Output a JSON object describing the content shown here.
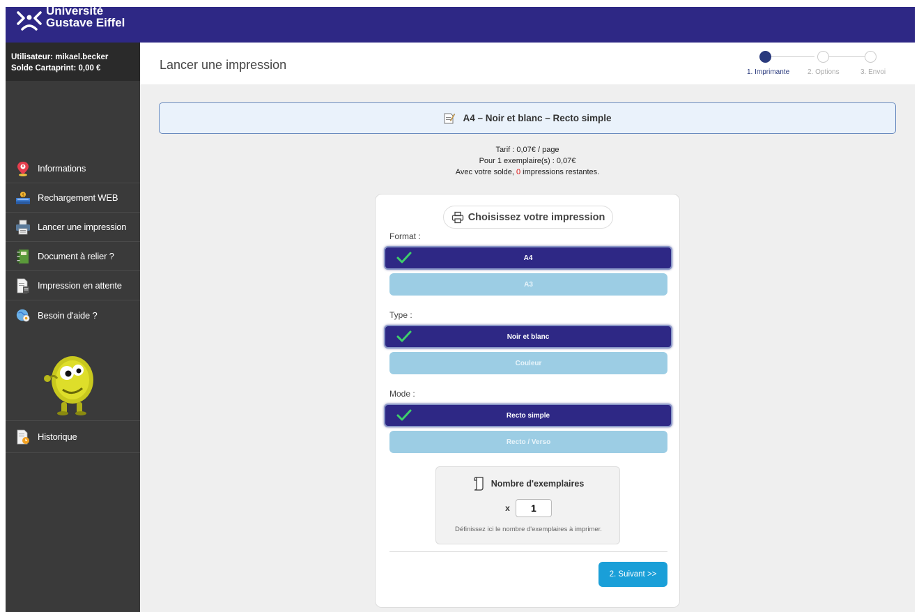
{
  "brand": {
    "line1": "Université",
    "line2": "Gustave Eiffel"
  },
  "user": {
    "username_line": "Utilisateur: mikael.becker",
    "balance_line": "Solde Cartaprint: 0,00 €"
  },
  "sidebar": {
    "items": [
      {
        "label": "Informations",
        "icon": "map-pin-icon"
      },
      {
        "label": "Rechargement WEB",
        "icon": "cash-register-icon"
      },
      {
        "label": "Lancer une impression",
        "icon": "printer-icon"
      },
      {
        "label": "Document à relier ?",
        "icon": "binder-icon"
      },
      {
        "label": "Impression en attente",
        "icon": "document-pending-icon"
      },
      {
        "label": "Besoin d'aide ?",
        "icon": "help-globe-icon"
      }
    ],
    "history": {
      "label": "Historique",
      "icon": "history-document-icon"
    }
  },
  "header": {
    "title": "Lancer une impression",
    "steps": [
      {
        "label": "1. Imprimante",
        "active": true
      },
      {
        "label": "2. Options",
        "active": false
      },
      {
        "label": "3. Envoi",
        "active": false
      }
    ]
  },
  "summary": {
    "text": "A4 – Noir et blanc – Recto simple"
  },
  "pricing": {
    "tarif": "Tarif : 0,07€ / page",
    "per_copies": "Pour 1 exemplaire(s) : 0,07€",
    "remaining_prefix": "Avec votre solde, ",
    "remaining_count": "0",
    "remaining_suffix": " impressions restantes."
  },
  "form": {
    "title": "Choisissez votre impression",
    "format": {
      "label": "Format :",
      "options": [
        "A4",
        "A3"
      ],
      "selected": "A4"
    },
    "type": {
      "label": "Type :",
      "options": [
        "Noir et blanc",
        "Couleur"
      ],
      "selected": "Noir et blanc"
    },
    "mode": {
      "label": "Mode :",
      "options": [
        "Recto simple",
        "Recto / Verso"
      ],
      "selected": "Recto simple"
    },
    "copies": {
      "title": "Nombre d'exemplaires",
      "prefix": "x",
      "value": "1",
      "help": "Définissez ici le nombre d'exemplaires à imprimer."
    },
    "next_label": "2. Suivant >>"
  },
  "colors": {
    "topbar": "#2e2885",
    "sidebar": "#3a3a3a",
    "selected_option": "#2e2885",
    "unselected_option": "#9ccde4",
    "next_button": "#1a9fd8",
    "check": "#3ecf6a"
  }
}
